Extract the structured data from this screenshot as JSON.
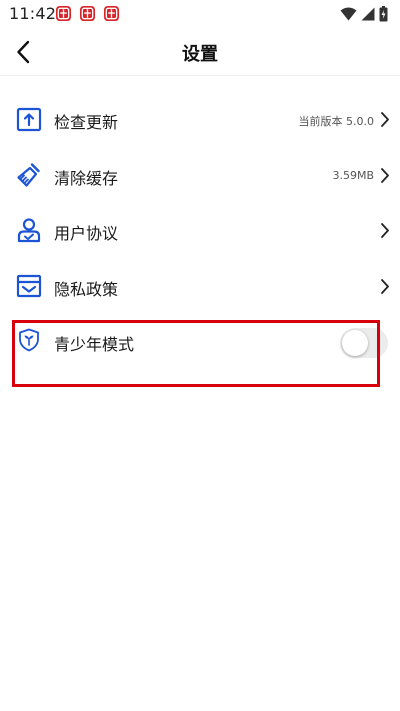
{
  "status_bar": {
    "time": "11:42",
    "notification_icons": [
      "app-notification-icon",
      "app-notification-icon",
      "app-notification-icon"
    ],
    "system_icons": [
      "wifi-icon",
      "cellular-signal-icon",
      "battery-charging-icon"
    ]
  },
  "header": {
    "back_icon": "chevron-left-icon",
    "title": "设置"
  },
  "settings": {
    "items": [
      {
        "icon": "update-icon",
        "label": "检查更新",
        "value": "当前版本 5.0.0",
        "has_chevron": true
      },
      {
        "icon": "broom-icon",
        "label": "清除缓存",
        "value": "3.59MB",
        "has_chevron": true
      },
      {
        "icon": "user-agreement-icon",
        "label": "用户协议",
        "value": "",
        "has_chevron": true
      },
      {
        "icon": "privacy-policy-icon",
        "label": "隐私政策",
        "value": "",
        "has_chevron": true
      },
      {
        "icon": "youth-shield-icon",
        "label": "青少年模式",
        "value": "",
        "has_chevron": false,
        "toggle_on": false
      }
    ]
  },
  "colors": {
    "accent": "#1d54d6",
    "notification_red": "#d6262b",
    "highlight": "#d9000d",
    "toggle_off_track": "#ececec"
  }
}
